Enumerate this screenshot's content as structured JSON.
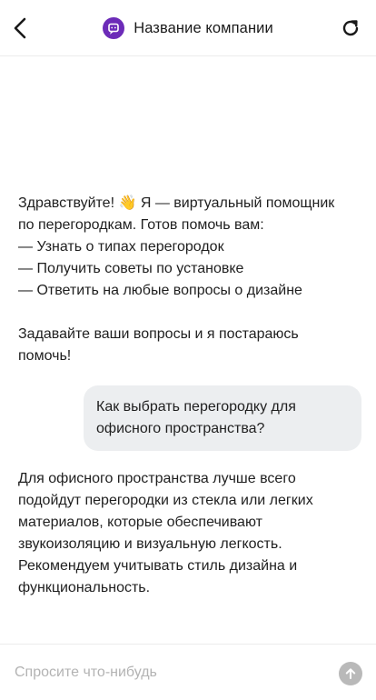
{
  "header": {
    "title": "Название компании",
    "back_icon": "chevron-left-icon",
    "reload_icon": "reload-icon",
    "logo_icon": "chat-bot-icon",
    "brand_color": "#6c2bb8"
  },
  "messages": {
    "greeting": {
      "lines": [
        "Здравствуйте! 👋 Я — виртуальный помощник",
        "по перегородкам. Готов помочь вам:",
        "— Узнать о типах перегородок",
        "— Получить советы по установке",
        "— Ответить на любые вопросы о дизайне"
      ],
      "followup_lines": [
        "Задавайте ваши вопросы и я постараюсь",
        "помочь!"
      ]
    },
    "user_question": {
      "lines": [
        "Как выбрать перегородку для",
        "офисного пространства?"
      ]
    },
    "answer": {
      "lines": [
        "Для офисного пространства лучше всего",
        "подойдут перегородки из стекла или легких",
        "материалов, которые обеспечивают",
        "звукоизоляцию и визуальную легкость.",
        "Рекомендуем учитывать стиль дизайна и",
        "функциональность."
      ]
    }
  },
  "composer": {
    "placeholder": "Спросите что-нибудь",
    "value": "",
    "send_icon": "arrow-up-icon",
    "send_color": "#b9b9b9"
  }
}
